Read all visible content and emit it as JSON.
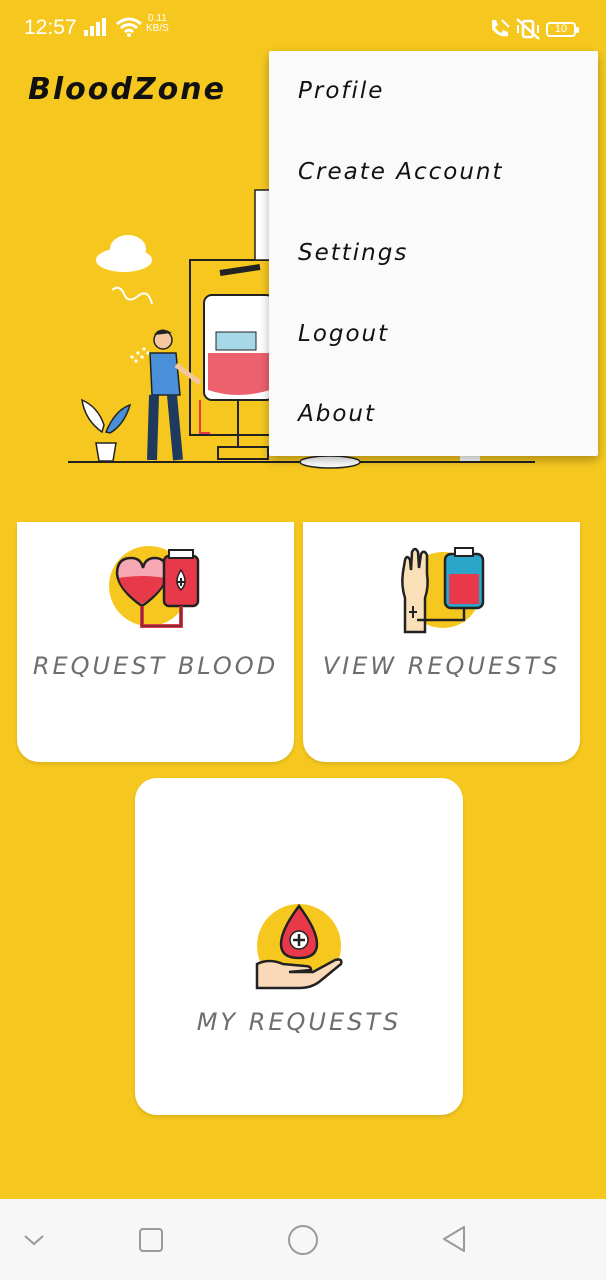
{
  "status_bar": {
    "time": "12:57",
    "net_speed_value": "0.11",
    "net_speed_unit": "KB/S",
    "battery": "10"
  },
  "app": {
    "title": "BloodZone"
  },
  "overflow_menu": {
    "items": [
      {
        "label": "Profile"
      },
      {
        "label": "Create Account"
      },
      {
        "label": "Settings"
      },
      {
        "label": "Logout"
      },
      {
        "label": "About"
      }
    ]
  },
  "cards": {
    "request_blood": {
      "label": "REQUEST BLOOD",
      "icon": "blood-bag-heart-icon"
    },
    "view_requests": {
      "label": "VIEW REQUESTS",
      "icon": "transfusion-arm-icon"
    },
    "my_requests": {
      "label": "MY REQUESTS",
      "icon": "hand-blood-drop-icon"
    }
  },
  "nav": {
    "icons": [
      "chevron-down-icon",
      "recents-square-icon",
      "home-circle-icon",
      "back-triangle-icon"
    ]
  },
  "colors": {
    "background": "#F6C81F",
    "card": "#FFFFFF",
    "accent_red": "#E8394A",
    "menu_bg": "#FAFAFA"
  }
}
